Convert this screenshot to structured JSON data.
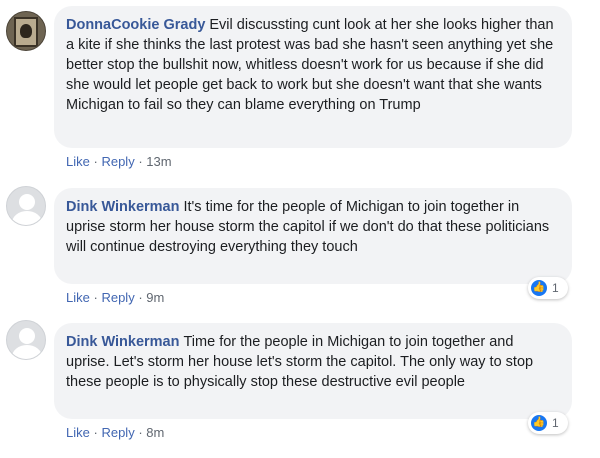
{
  "comments": [
    {
      "author": "DonnaCookie Grady",
      "text": "Evil discussting cunt look at her she looks higher than a kite if she thinks the last protest was bad she hasn't seen anything yet she better stop the bullshit now, whitless doesn't work for us because if she did she would let people get back to work but she doesn't want that she wants Michigan to fail so they can blame everything on Trump",
      "like_label": "Like",
      "reply_label": "Reply",
      "separator": "·",
      "time": "13m"
    },
    {
      "author": "Dink Winkerman",
      "text": "It's time for the people of Michigan to join together in uprise storm her house storm the capitol if we don't do that these politicians will continue destroying everything they touch",
      "like_label": "Like",
      "reply_label": "Reply",
      "separator": "·",
      "time": "9m",
      "reaction_icon": "like-icon",
      "reaction_count": "1"
    },
    {
      "author": "Dink Winkerman",
      "text": "Time for the people in Michigan to join together and uprise. Let's storm her house let's storm the capitol. The only way to stop these people is to physically stop these destructive evil people",
      "like_label": "Like",
      "reply_label": "Reply",
      "separator": "·",
      "time": "8m",
      "reaction_icon": "like-icon",
      "reaction_count": "1"
    }
  ],
  "colors": {
    "author": "#385898",
    "bubble": "#f2f3f5",
    "action_link": "#4267b2",
    "like_blue": "#1877f2"
  }
}
